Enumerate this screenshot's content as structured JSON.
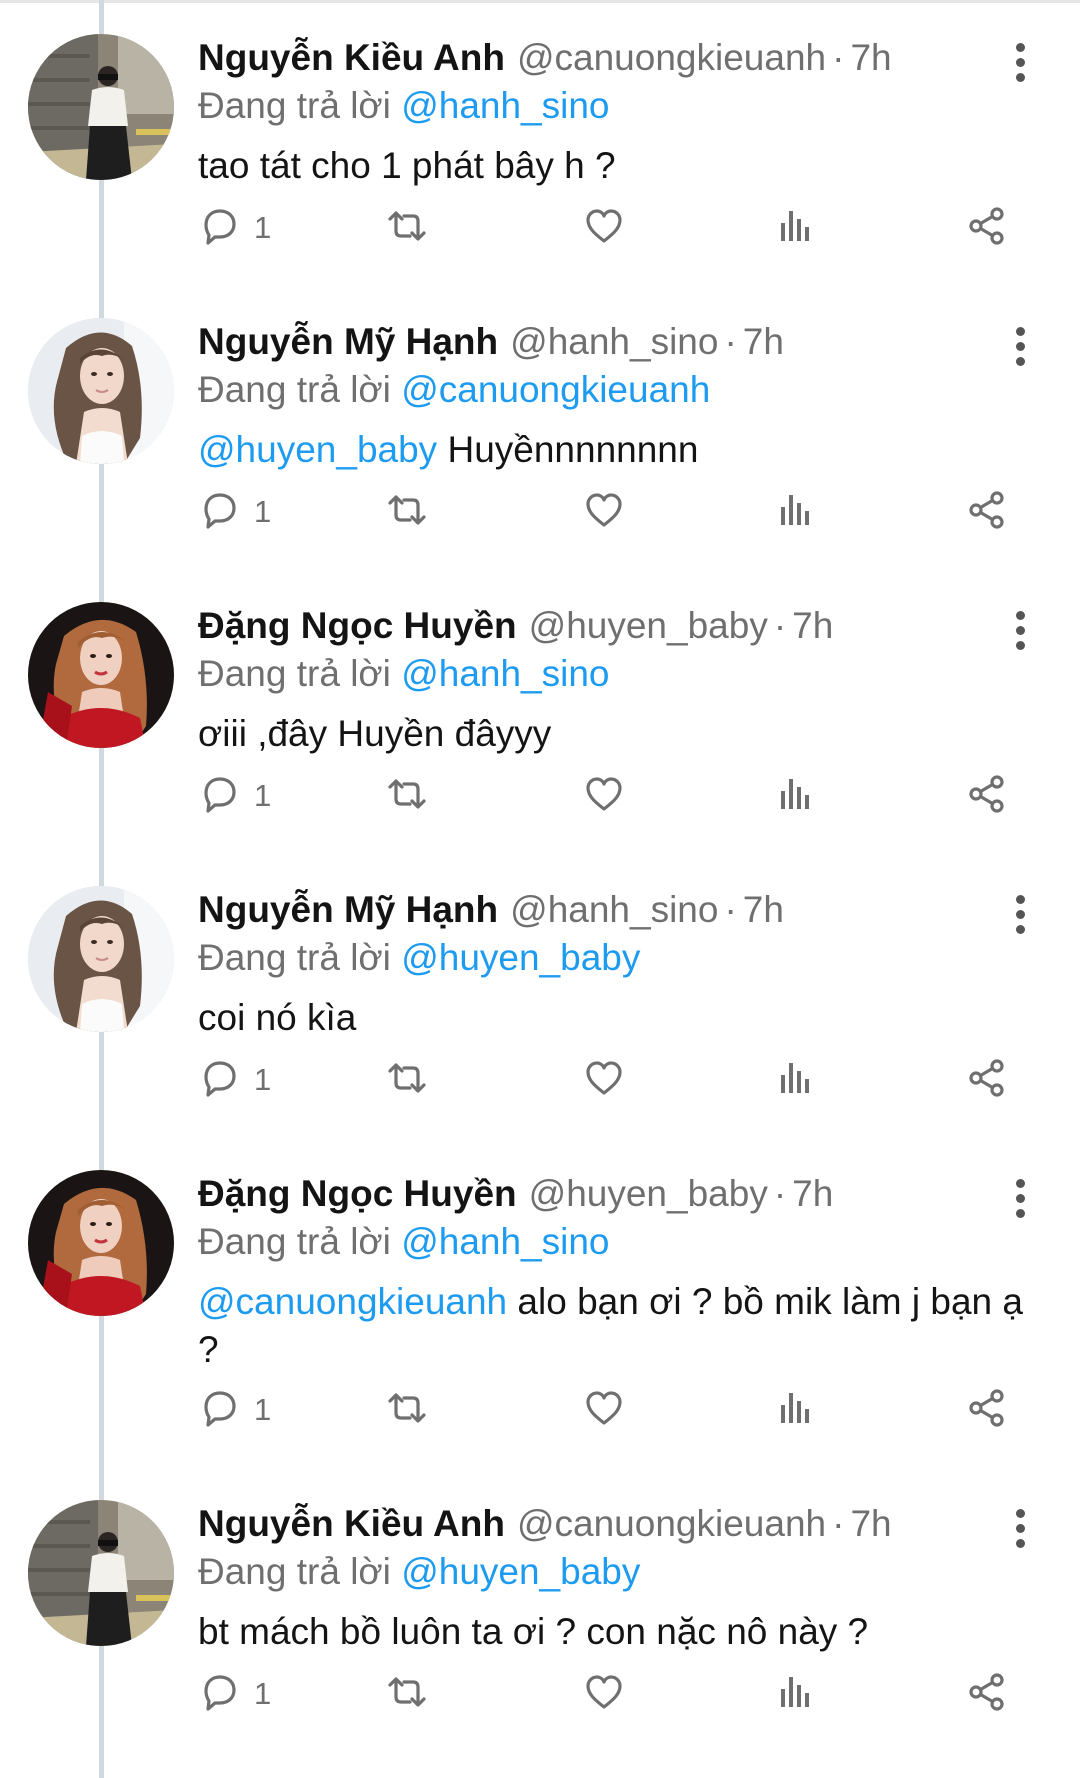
{
  "ui": {
    "reply_prefix": "Đang trả lời",
    "dot": "·"
  },
  "colors": {
    "link": "#1d9bf0",
    "muted": "#6f6f6f",
    "text": "#141414",
    "thread_line": "#cfd9de"
  },
  "tweets": [
    {
      "display_name": "Nguyễn Kiều Anh",
      "handle": "@canuongkieuanh",
      "time": "7h",
      "replying_to": "@hanh_sino",
      "mention": "",
      "text": "tao tát cho 1 phát bây h ?",
      "reply_count": "1",
      "avatar": "street-photo"
    },
    {
      "display_name": "Nguyễn Mỹ Hạnh",
      "handle": "@hanh_sino",
      "time": "7h",
      "replying_to": "@canuongkieuanh",
      "mention": "@huyen_baby",
      "text": " Huyềnnnnnnnn",
      "reply_count": "1",
      "avatar": "portrait-light"
    },
    {
      "display_name": "Đặng Ngọc Huyền",
      "handle": "@huyen_baby",
      "time": "7h",
      "replying_to": "@hanh_sino",
      "mention": "",
      "text": "ơiii ,đây Huyền đâyyy",
      "reply_count": "1",
      "avatar": "portrait-red"
    },
    {
      "display_name": "Nguyễn Mỹ Hạnh",
      "handle": "@hanh_sino",
      "time": "7h",
      "replying_to": "@huyen_baby",
      "mention": "",
      "text": "coi nó kìa",
      "reply_count": "1",
      "avatar": "portrait-light"
    },
    {
      "display_name": "Đặng Ngọc Huyền",
      "handle": "@huyen_baby",
      "time": "7h",
      "replying_to": "@hanh_sino",
      "mention": "@canuongkieuanh",
      "text": " alo bạn ơi ? bồ mik làm j bạn ạ ?",
      "reply_count": "1",
      "avatar": "portrait-red"
    },
    {
      "display_name": "Nguyễn Kiều Anh",
      "handle": "@canuongkieuanh",
      "time": "7h",
      "replying_to": "@huyen_baby",
      "mention": "",
      "text": "bt mách bồ luôn ta ơi ? con nặc nô này ?",
      "reply_count": "1",
      "avatar": "street-photo"
    }
  ]
}
